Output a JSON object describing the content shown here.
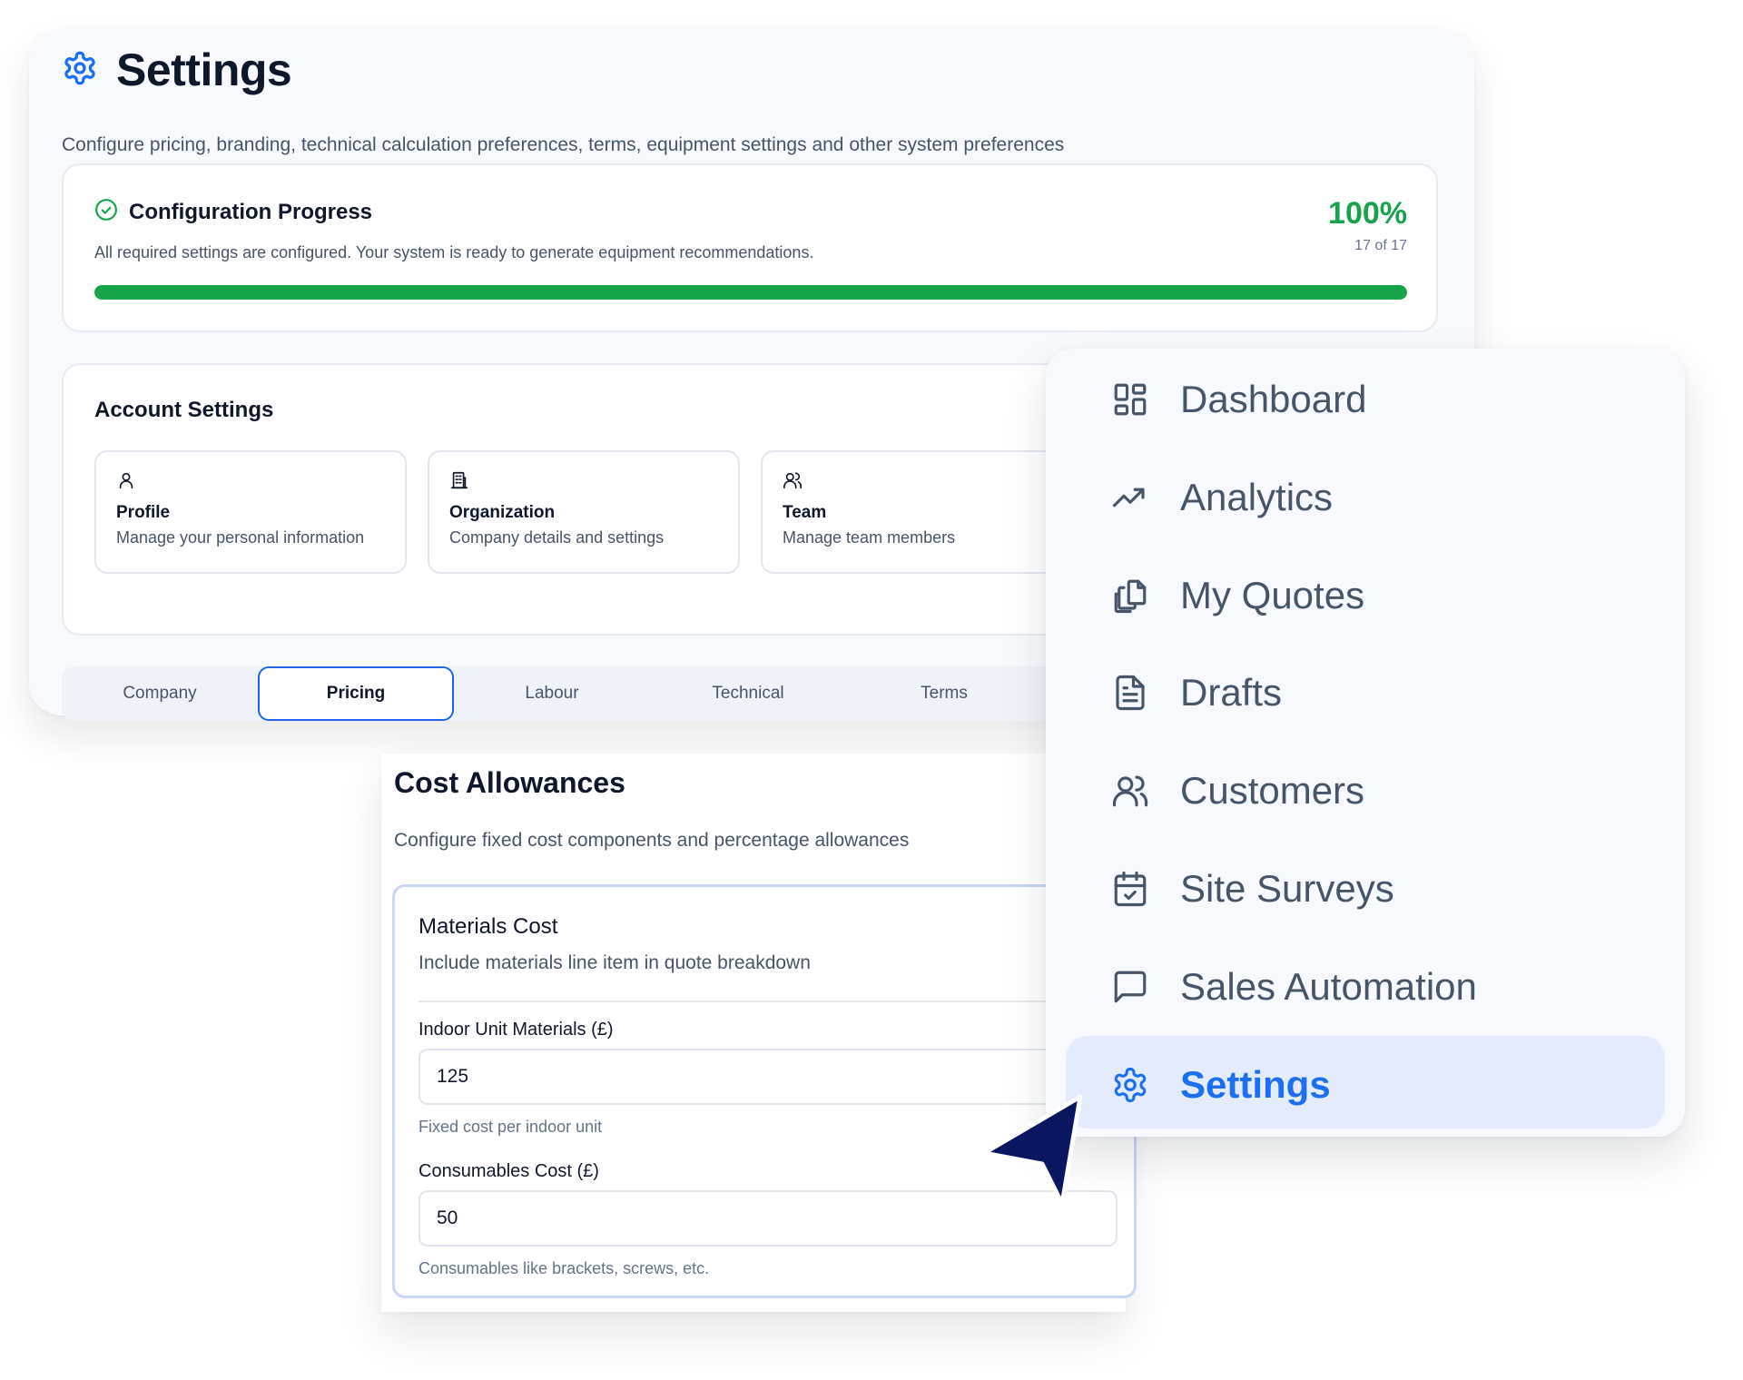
{
  "page": {
    "title": "Settings",
    "subtitle": "Configure pricing, branding, technical calculation preferences, terms, equipment settings and other system preferences",
    "title_icon": "gear-icon"
  },
  "progress": {
    "title": "Configuration Progress",
    "description": "All required settings are configured. Your system is ready to generate equipment recommendations.",
    "percent_label": "100%",
    "count_label": "17 of 17",
    "fraction": 1.0,
    "color": "#16a34a",
    "icon": "check-circle-icon"
  },
  "account": {
    "title": "Account Settings",
    "tiles": [
      {
        "name": "Profile",
        "description": "Manage your personal information",
        "icon": "user-icon"
      },
      {
        "name": "Organization",
        "description": "Company details and settings",
        "icon": "building-icon"
      },
      {
        "name": "Team",
        "description": "Manage team members",
        "icon": "users-icon"
      }
    ]
  },
  "tabs": [
    {
      "label": "Company",
      "active": false
    },
    {
      "label": "Pricing",
      "active": true
    },
    {
      "label": "Labour",
      "active": false
    },
    {
      "label": "Technical",
      "active": false
    },
    {
      "label": "Terms",
      "active": false
    }
  ],
  "cost": {
    "title": "Cost Allowances",
    "subtitle": "Configure fixed cost components and percentage allowances",
    "materials": {
      "title": "Materials Cost",
      "description": "Include materials line item in quote breakdown",
      "fields": [
        {
          "label": "Indoor Unit Materials (£)",
          "value": "125",
          "hint": "Fixed cost per indoor unit"
        },
        {
          "label": "Consumables Cost (£)",
          "value": "50",
          "hint": "Consumables like brackets, screws, etc."
        }
      ]
    }
  },
  "sidebar": {
    "items": [
      {
        "label": "Dashboard",
        "icon": "dashboard-icon",
        "active": false
      },
      {
        "label": "Analytics",
        "icon": "trending-up-icon",
        "active": false
      },
      {
        "label": "My Quotes",
        "icon": "quotes-icon",
        "active": false
      },
      {
        "label": "Drafts",
        "icon": "document-icon",
        "active": false
      },
      {
        "label": "Customers",
        "icon": "users-icon",
        "active": false
      },
      {
        "label": "Site Surveys",
        "icon": "calendar-check-icon",
        "active": false
      },
      {
        "label": "Sales Automation",
        "icon": "message-icon",
        "active": false
      },
      {
        "label": "Settings",
        "icon": "gear-icon",
        "active": true
      }
    ],
    "accent_color": "#1d6ff2"
  },
  "cursor": {
    "icon": "cursor-arrow-icon",
    "color": "#0b1660"
  }
}
